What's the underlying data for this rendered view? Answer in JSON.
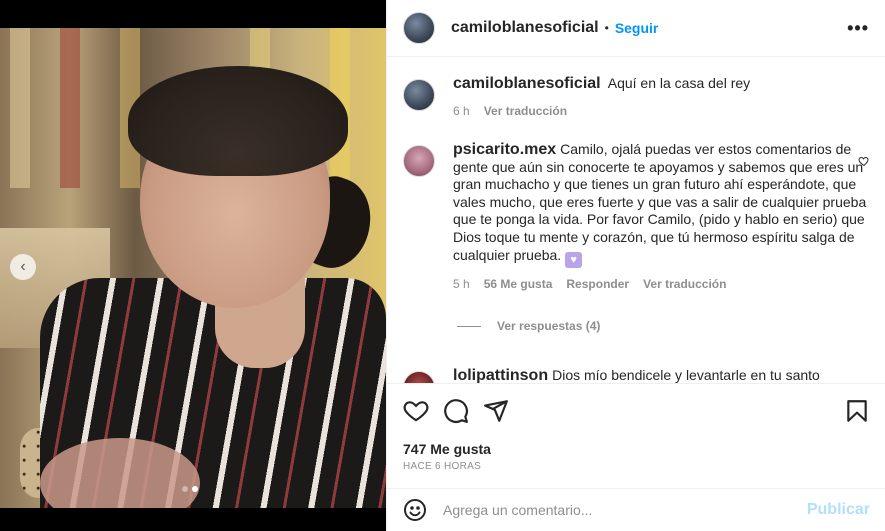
{
  "post": {
    "username": "camiloblanesoficial",
    "follow_label": "Seguir",
    "separator": "•",
    "more_icon": "more-horizontal-icon"
  },
  "caption": {
    "username": "camiloblanesoficial",
    "text": "Aquí en la casa del rey",
    "time": "6 h",
    "translate_label": "Ver traducción"
  },
  "comments": [
    {
      "username": "psicarito.mex",
      "text": "Camilo, ojalá puedas ver estos comentarios de gente que aún sin conocerte te apoyamos y sabemos que eres un gran muchacho y que tienes un gran futuro ahí esperándote, que vales mucho, que eres fuerte y que vas a salir de cualquier prueba que te ponga la vida. Por favor Camilo, (pido y hablo en serio) que Dios toque tu mente y corazón, que tú hermoso espíritu salga de cualquier prueba.",
      "time": "5 h",
      "likes_label": "56 Me gusta",
      "reply_label": "Responder",
      "translate_label": "Ver traducción",
      "view_replies_label": "Ver respuestas (4)"
    },
    {
      "username": "lolipattinson",
      "text": "Dios mío bendicele y levantarle en tu santo"
    }
  ],
  "actions": {
    "like_icon": "heart-icon",
    "comment_icon": "comment-icon",
    "share_icon": "send-icon",
    "save_icon": "bookmark-icon"
  },
  "stats": {
    "likes": "747 Me gusta",
    "posted": "HACE 6 HORAS"
  },
  "composer": {
    "placeholder": "Agrega un comentario...",
    "post_label": "Publicar",
    "emoji_icon": "smiley-icon"
  },
  "carousel": {
    "prev_icon": "chevron-left-icon",
    "count": 2,
    "active_index": 1
  },
  "colors": {
    "accent": "#0095f6",
    "accent_disabled": "#b2dffc",
    "muted": "#8e8e8e"
  }
}
